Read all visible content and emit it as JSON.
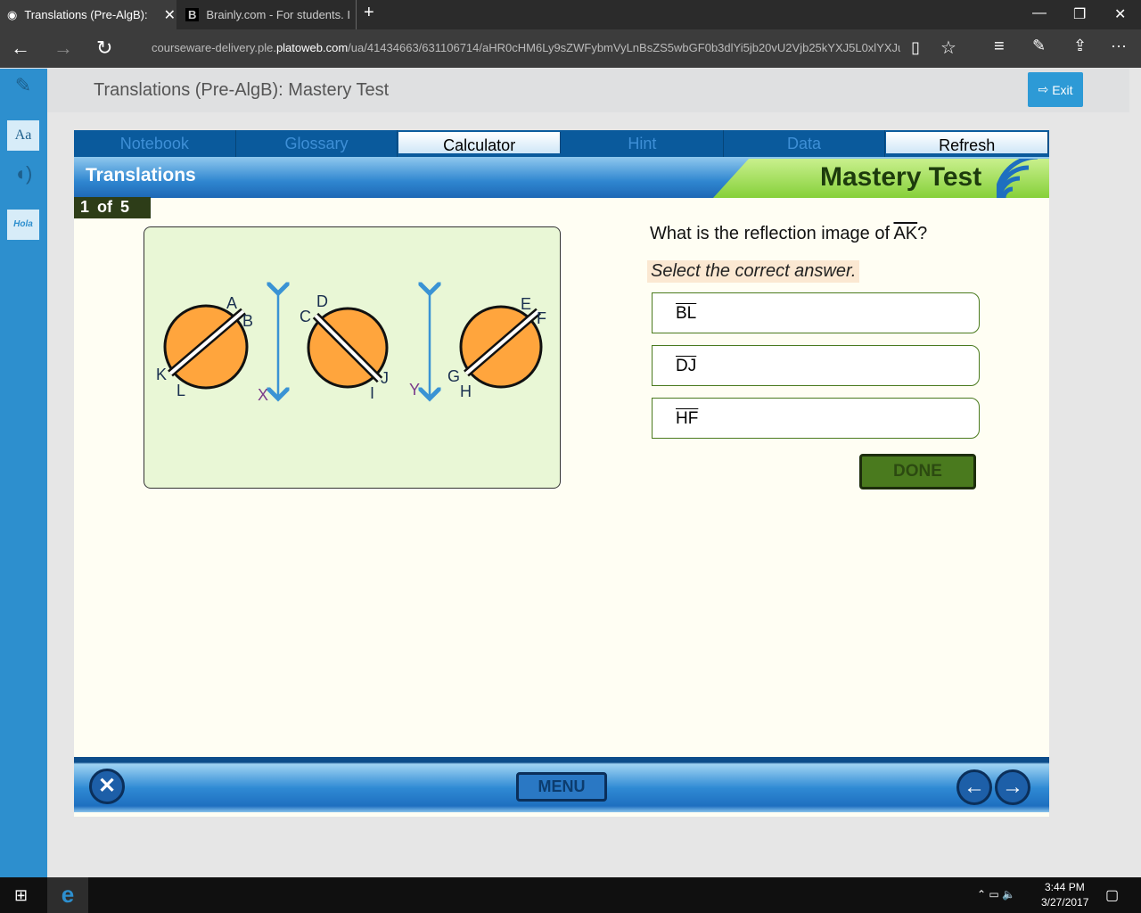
{
  "browser": {
    "tabs": [
      {
        "title": "Translations (Pre-AlgB):"
      },
      {
        "title": "Brainly.com - For students. I"
      }
    ],
    "url_prefix": "courseware-delivery.ple.",
    "url_domain": "platoweb.com",
    "url_rest": "/ua/41434663/631106714/aHR0cHM6Ly9sZWFybmVyLnBsZS5wbGF0b3dlYi5jb20vU2Vjb25kYXJ5L0xlYXJua"
  },
  "app": {
    "title": "Translations (Pre-AlgB): Mastery Test",
    "exit_label": "Exit",
    "hola": "Hola"
  },
  "toolbar": {
    "items": [
      "Notebook",
      "Glossary",
      "Calculator",
      "Hint",
      "Data",
      "Refresh"
    ]
  },
  "banner": {
    "title": "Translations",
    "mode": "Mastery Test"
  },
  "counter": "1 of 5",
  "figure": {
    "labels": [
      "A",
      "B",
      "K",
      "L",
      "C",
      "D",
      "I",
      "J",
      "E",
      "F",
      "G",
      "H",
      "X",
      "Y"
    ]
  },
  "question": {
    "prefix": "What is the reflection image of ",
    "segment": "AK",
    "suffix": "?",
    "instruction": "Select the correct answer.",
    "options": [
      "BL",
      "DJ",
      "HF"
    ],
    "done_label": "DONE"
  },
  "footer": {
    "menu_label": "MENU"
  },
  "taskbar": {
    "time": "3:44 PM",
    "date": "3/27/2017"
  },
  "colors": {
    "accent": "#2d8fce",
    "orange": "#ffa53d",
    "green": "#86d03a"
  }
}
